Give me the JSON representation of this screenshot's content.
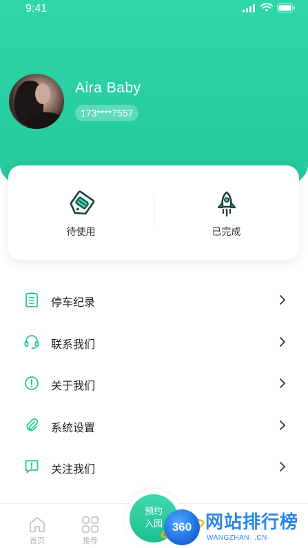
{
  "status_bar": {
    "time": "9:41"
  },
  "profile": {
    "name": "Aira Baby",
    "phone": "173****7557"
  },
  "orders": {
    "items": [
      {
        "label": "待使用",
        "icon": "coupon-tag-icon"
      },
      {
        "label": "已完成",
        "icon": "rocket-icon"
      }
    ]
  },
  "menu": {
    "items": [
      {
        "label": "停车纪录",
        "icon": "clipboard-list-icon"
      },
      {
        "label": "联系我们",
        "icon": "headset-icon"
      },
      {
        "label": "关于我们",
        "icon": "info-circle-icon"
      },
      {
        "label": "系统设置",
        "icon": "paperclip-icon"
      },
      {
        "label": "关注我们",
        "icon": "alert-message-icon"
      }
    ]
  },
  "tabbar": {
    "home_label": "首页",
    "recommend_label": "推荐",
    "reserve_line1": "预约",
    "reserve_line2": "入园"
  },
  "watermark": {
    "logo_text": "360",
    "title": "网站排行榜",
    "subtitle": "WANGZHAN·  .CN·"
  },
  "colors": {
    "accent": "#23c79b",
    "accent_light": "#2fd6a9",
    "icon_dark": "#1f3a3a",
    "text": "#222222",
    "tab_inactive": "#b5b5b5"
  }
}
